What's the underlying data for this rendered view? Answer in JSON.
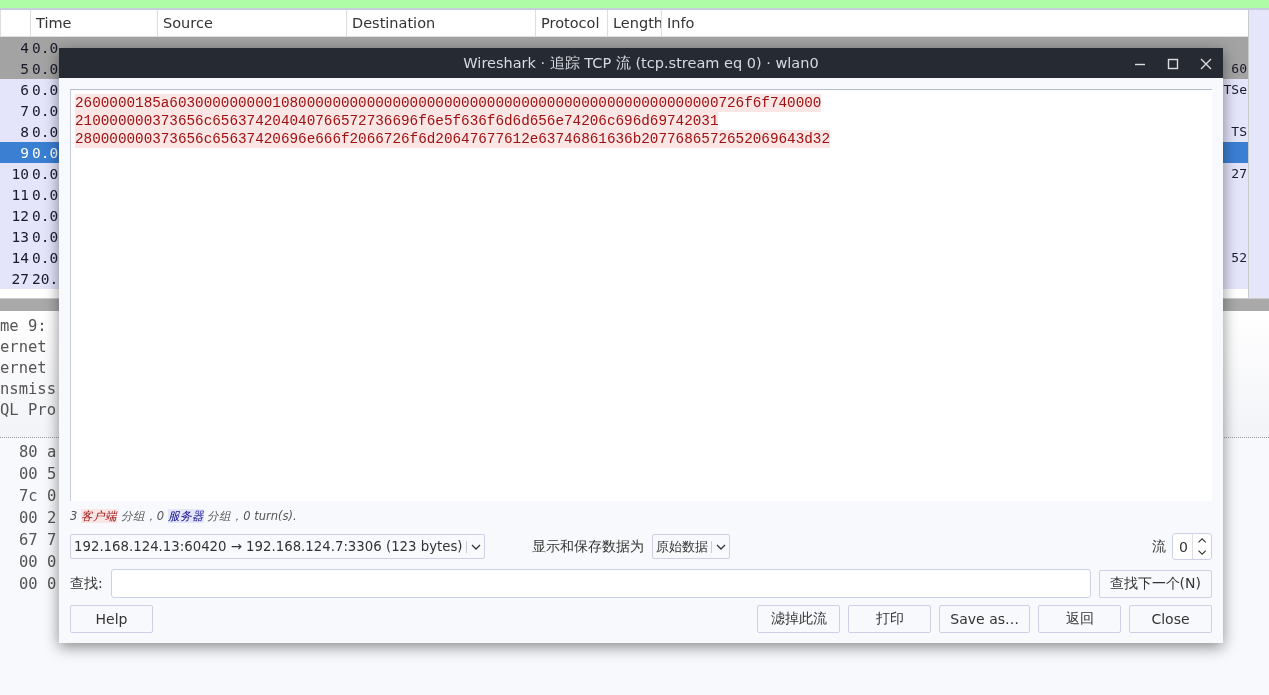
{
  "packet_list": {
    "columns": [
      "Time",
      "Source",
      "Destination",
      "Protocol",
      "Length",
      "Info"
    ],
    "rows": [
      {
        "no": "4",
        "time": "0.0",
        "selected": false,
        "color": "#a3a3a3"
      },
      {
        "no": "5",
        "time": "0.0",
        "info": "60",
        "selected": false,
        "color": "#a3a3a3"
      },
      {
        "no": "6",
        "time": "0.0",
        "info": "TSe",
        "selected": false,
        "color": "#e4e4fb"
      },
      {
        "no": "7",
        "time": "0.0",
        "selected": false,
        "color": "#e4e4fb"
      },
      {
        "no": "8",
        "time": "0.0",
        "info": "TS",
        "selected": false,
        "color": "#e4e4fb"
      },
      {
        "no": "9",
        "time": "0.0",
        "selected": true
      },
      {
        "no": "10",
        "time": "0.0",
        "info": "27",
        "selected": false,
        "color": "#e4e4fb"
      },
      {
        "no": "11",
        "time": "0.0",
        "selected": false,
        "color": "#e4e4fb"
      },
      {
        "no": "12",
        "time": "0.0",
        "selected": false,
        "color": "#e4e4fb"
      },
      {
        "no": "13",
        "time": "0.0",
        "selected": false,
        "color": "#e4e4fb"
      },
      {
        "no": "14",
        "time": "0.0",
        "info": "52",
        "selected": false,
        "color": "#e4e4fb"
      },
      {
        "no": "27",
        "time": "20.",
        "selected": false,
        "color": "#e4e4fb"
      }
    ]
  },
  "details": [
    "me 9:",
    "ernet",
    "ernet",
    "nsmiss",
    "QL Pro"
  ],
  "bytes": [
    "80 a",
    "00 5",
    "7c 0",
    "00 2",
    "67 7",
    "00 0",
    "00 0"
  ],
  "dialog": {
    "title": "Wireshark · 追踪 TCP 流 (tcp.stream eq 0) · wlan0",
    "stream_lines": [
      "2600000185a6030000000001080000000000000000000000000000000000000000000000000726f6f740000",
      "210000000373656c656374204040766572736696f6e5f636f6d6d656e74206c696d69742031",
      "280000000373656c65637420696e666f2066726f6d20647677612e63746861636b2077686572652069643d32"
    ],
    "summary": [
      {
        "kind": "plain",
        "text": "3 "
      },
      {
        "kind": "client",
        "text": "客户端"
      },
      {
        "kind": "plain",
        "text": " 分组，0 "
      },
      {
        "kind": "server",
        "text": "服务器"
      },
      {
        "kind": "plain",
        "text": " 分组，0 turn(s)."
      }
    ],
    "conversation": "192.168.124.13:60420 → 192.168.124.7:3306 (123 bytes)",
    "show_as_label": "显示和保存数据为",
    "show_as": "原始数据",
    "stream_label": "流",
    "stream": "0",
    "find_label": "查找:",
    "find_next": "查找下一个(N)",
    "help": "Help",
    "buttons": [
      "滤掉此流",
      "打印",
      "Save as…",
      "返回",
      "Close"
    ]
  }
}
